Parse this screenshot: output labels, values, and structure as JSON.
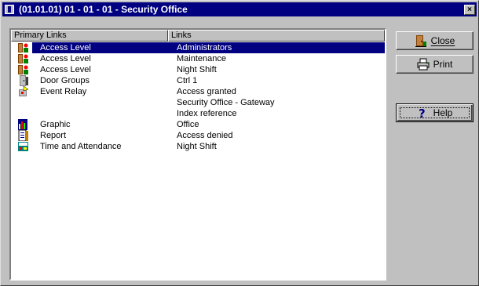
{
  "window": {
    "title": "(01.01.01) 01 - 01 - 01 - Security Office",
    "close_glyph": "×"
  },
  "list": {
    "columns": [
      "Primary Links",
      "Links"
    ],
    "rows": [
      {
        "primary": "Access Level",
        "link": "Administrators",
        "icon": "access-level-icon",
        "selected": true
      },
      {
        "primary": "Access Level",
        "link": "Maintenance",
        "icon": "access-level-icon"
      },
      {
        "primary": "Access Level",
        "link": "Night Shift",
        "icon": "access-level-icon"
      },
      {
        "primary": "Door Groups",
        "link": "Ctrl 1",
        "icon": "door-group-icon"
      },
      {
        "primary": "Event Relay",
        "link": "Access granted",
        "icon": "event-relay-icon"
      },
      {
        "primary": "",
        "link": "Security Office - Gateway",
        "icon": ""
      },
      {
        "primary": "",
        "link": "Index reference",
        "icon": ""
      },
      {
        "primary": "Graphic",
        "link": "Office",
        "icon": "graphic-icon"
      },
      {
        "primary": "Report",
        "link": "Access denied",
        "icon": "report-icon"
      },
      {
        "primary": "Time and Attendance",
        "link": "Night Shift",
        "icon": "time-attendance-icon"
      }
    ]
  },
  "buttons": {
    "close": "Close",
    "print": "Print",
    "help": "Help"
  },
  "colors": {
    "title_bar": "#000080",
    "selection": "#000080",
    "face": "#c0c0c0"
  }
}
